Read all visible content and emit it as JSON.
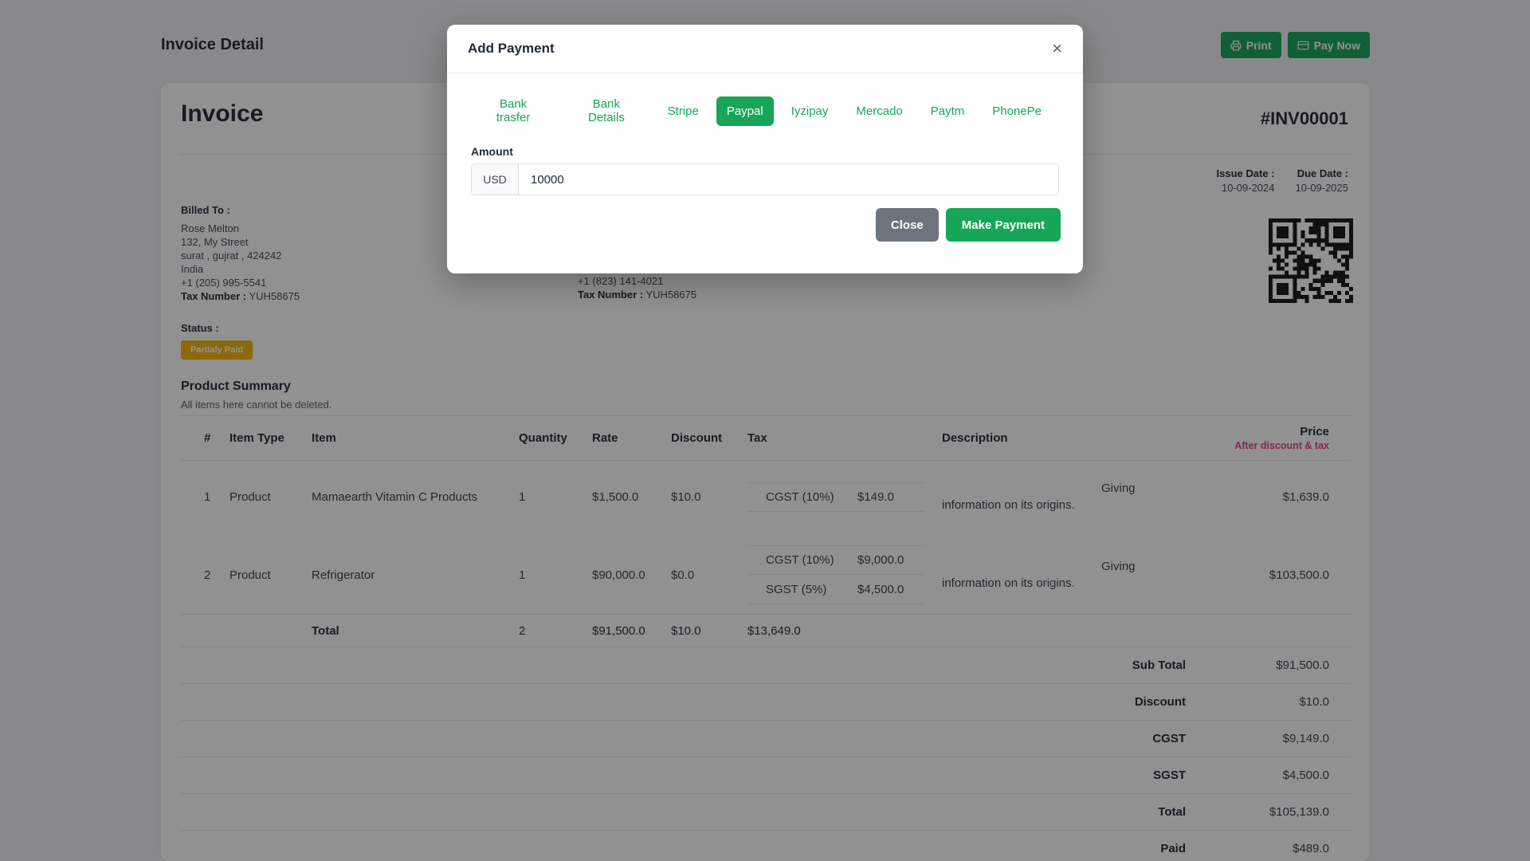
{
  "colors": {
    "accent": "#17a658",
    "secondary": "#6c757d",
    "badge": "#f5b40a",
    "price_note": "#e83e8c",
    "overlay": "rgba(12,12,12,0.45)"
  },
  "page": {
    "title": "Invoice Detail",
    "print_label": "Print",
    "pay_now_label": "Pay Now"
  },
  "invoice": {
    "heading": "Invoice",
    "number": "#INV00001",
    "billed_to": {
      "label": "Billed To :",
      "lines": [
        "Rose Melton",
        "132, My Street",
        "surat , gujrat , 424242",
        "India",
        "+1 (205) 995-5541"
      ],
      "tax_label": "Tax Number :",
      "tax_value": "YUH58675"
    },
    "shipped_to": {
      "phone": "+1 (823) 141-4021",
      "tax_label": "Tax Number :",
      "tax_value": "YUH58675"
    },
    "issue_date_label": "Issue Date :",
    "issue_date": "10-09-2024",
    "due_date_label": "Due Date :",
    "due_date": "10-09-2025",
    "status_label": "Status :",
    "status_badge": "Partialy Paid",
    "section_title": "Product Summary",
    "section_subtitle": "All items here cannot be deleted."
  },
  "table": {
    "headers": [
      "#",
      "Item Type",
      "Item",
      "Quantity",
      "Rate",
      "Discount",
      "Tax",
      "Description",
      "Price"
    ],
    "price_note": "After discount & tax",
    "rows": [
      {
        "num": "1",
        "type": "Product",
        "item": "Mamaearth Vitamin C Products",
        "qty": "1",
        "rate": "$1,500.0",
        "discount": "$10.0",
        "taxes": [
          {
            "name": "CGST (10%)",
            "amount": "$149.0"
          }
        ],
        "description": "Giving information on its origins.",
        "price": "$1,639.0"
      },
      {
        "num": "2",
        "type": "Product",
        "item": "Refrigerator",
        "qty": "1",
        "rate": "$90,000.0",
        "discount": "$0.0",
        "taxes": [
          {
            "name": "CGST (10%)",
            "amount": "$9,000.0"
          },
          {
            "name": "SGST (5%)",
            "amount": "$4,500.0"
          }
        ],
        "description": "Giving information on its origins.",
        "price": "$103,500.0"
      }
    ],
    "footer": {
      "label": "Total",
      "qty": "2",
      "rate": "$91,500.0",
      "discount": "$10.0",
      "tax": "$13,649.0"
    },
    "summary": [
      {
        "label": "Sub Total",
        "value": "$91,500.0"
      },
      {
        "label": "Discount",
        "value": "$10.0"
      },
      {
        "label": "CGST",
        "value": "$9,149.0"
      },
      {
        "label": "SGST",
        "value": "$4,500.0"
      },
      {
        "label": "Total",
        "value": "$105,139.0"
      },
      {
        "label": "Paid",
        "value": "$489.0"
      }
    ]
  },
  "modal": {
    "title": "Add Payment",
    "close_icon": "×",
    "tabs": [
      "Bank trasfer",
      "Bank Details",
      "Stripe",
      "Paypal",
      "Iyzipay",
      "Mercado",
      "Paytm",
      "PhonePe"
    ],
    "active_tab": "Paypal",
    "amount_label": "Amount",
    "currency": "USD",
    "amount_value": "10000",
    "close_label": "Close",
    "make_payment_label": "Make Payment"
  }
}
